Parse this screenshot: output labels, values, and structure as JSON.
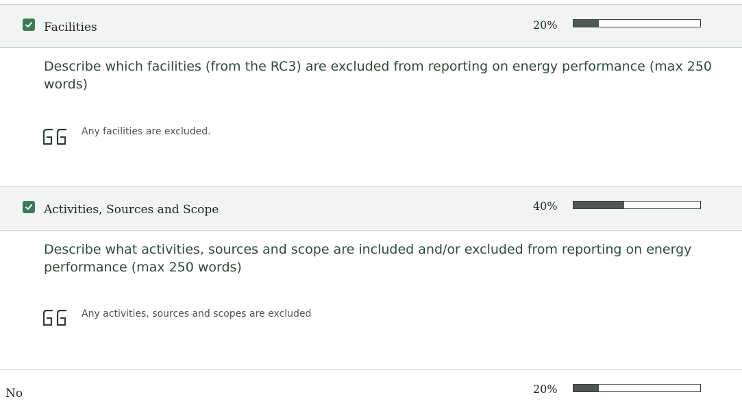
{
  "sections": [
    {
      "title": "Facilities",
      "checked": true,
      "progress_label": "20%",
      "progress": 0.2,
      "question": "Describe which facilities (from the RC3) are excluded from reporting on energy performance (max 250 words)",
      "answer": "Any facilities are excluded.",
      "quote_icon": "quote-icon"
    },
    {
      "title": "Activities, Sources and Scope",
      "checked": true,
      "progress_label": "40%",
      "progress": 0.4,
      "question": "Describe what activities, sources and scope are included and/or excluded from reporting on energy performance (max 250 words)",
      "answer": "Any activities, sources and scopes are excluded",
      "quote_icon": "quote-icon"
    }
  ],
  "footer_row": {
    "label": "No",
    "progress_label": "20%",
    "progress": 0.2
  },
  "colors": {
    "checkbox": "#3b7a55",
    "header_bg": "#f2f4f2",
    "bar_fill": "#4f5753",
    "question_text": "#2f4a3a"
  }
}
